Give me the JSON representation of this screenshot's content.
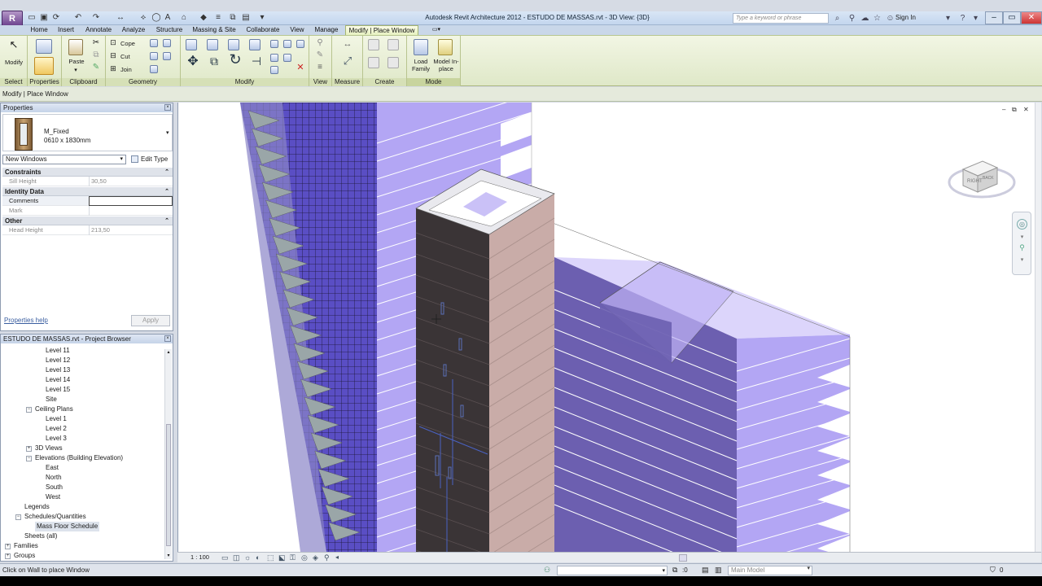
{
  "app": {
    "logo_letter": "R",
    "title": "Autodesk Revit Architecture 2012 -   ESTUDO DE MASSAS.rvt - 3D View: {3D}",
    "search_placeholder": "Type a keyword or phrase",
    "sign_in": "Sign In"
  },
  "tabs": [
    "Home",
    "Insert",
    "Annotate",
    "Analyze",
    "Structure",
    "Massing & Site",
    "Collaborate",
    "View",
    "Manage",
    "Modify | Place Window"
  ],
  "active_tab": "Modify | Place Window",
  "ribbon": {
    "panels": [
      "Select",
      "Properties",
      "Clipboard",
      "Geometry",
      "Modify",
      "View",
      "Measure",
      "Create",
      "Mode"
    ],
    "modify_label": "Modify",
    "paste_label": "Paste",
    "cope_label": "Cope",
    "cut_label": "Cut",
    "join_label": "Join",
    "load_family_label": "Load Family",
    "model_inplace_label": "Model In-place"
  },
  "options_bar": "Modify | Place Window",
  "properties": {
    "title": "Properties",
    "type_name": "M_Fixed",
    "type_size": "0610 x 1830mm",
    "instance_selector": "New Windows",
    "edit_type": "Edit Type",
    "groups": [
      {
        "name": "Constraints",
        "rows": [
          {
            "key": "Sill Height",
            "value": "30,50"
          }
        ]
      },
      {
        "name": "Identity Data",
        "rows": [
          {
            "key": "Comments",
            "value": ""
          },
          {
            "key": "Mark",
            "value": ""
          }
        ]
      },
      {
        "name": "Other",
        "rows": [
          {
            "key": "Head Height",
            "value": "213,50"
          }
        ]
      }
    ],
    "help_link": "Properties help",
    "apply": "Apply"
  },
  "browser": {
    "title": "ESTUDO DE MASSAS.rvt - Project Browser",
    "items": [
      {
        "label": "Level 11",
        "indent": 3,
        "exp": ""
      },
      {
        "label": "Level 12",
        "indent": 3,
        "exp": ""
      },
      {
        "label": "Level 13",
        "indent": 3,
        "exp": ""
      },
      {
        "label": "Level 14",
        "indent": 3,
        "exp": ""
      },
      {
        "label": "Level 15",
        "indent": 3,
        "exp": ""
      },
      {
        "label": "Site",
        "indent": 3,
        "exp": ""
      },
      {
        "label": "Ceiling Plans",
        "indent": 2,
        "exp": "-"
      },
      {
        "label": "Level 1",
        "indent": 3,
        "exp": ""
      },
      {
        "label": "Level 2",
        "indent": 3,
        "exp": ""
      },
      {
        "label": "Level 3",
        "indent": 3,
        "exp": ""
      },
      {
        "label": "3D Views",
        "indent": 2,
        "exp": "+"
      },
      {
        "label": "Elevations (Building Elevation)",
        "indent": 2,
        "exp": "-"
      },
      {
        "label": "East",
        "indent": 3,
        "exp": ""
      },
      {
        "label": "North",
        "indent": 3,
        "exp": ""
      },
      {
        "label": "South",
        "indent": 3,
        "exp": ""
      },
      {
        "label": "West",
        "indent": 3,
        "exp": ""
      },
      {
        "label": "Legends",
        "indent": 1,
        "exp": ""
      },
      {
        "label": "Schedules/Quantities",
        "indent": 1,
        "exp": "-"
      },
      {
        "label": "Mass Floor Schedule",
        "indent": 2,
        "exp": ""
      },
      {
        "label": "Sheets (all)",
        "indent": 1,
        "exp": ""
      },
      {
        "label": "Families",
        "indent": 0,
        "exp": "+"
      },
      {
        "label": "Groups",
        "indent": 0,
        "exp": "+"
      }
    ]
  },
  "viewcube_labels": [
    "RIGHT",
    "BACK"
  ],
  "view_control": {
    "scale": "1 : 100"
  },
  "status": {
    "message": "Click on Wall to place Window",
    "count": ":0",
    "model": "Main Model",
    "filter": "0"
  },
  "colors": {
    "mass_purple": "#b3a6f4",
    "mass_dark": "#6c5fb0",
    "tower_dark": "#3a3436",
    "tower_pink": "#c9aca8",
    "ribbon_bg": "#e6edd3"
  }
}
